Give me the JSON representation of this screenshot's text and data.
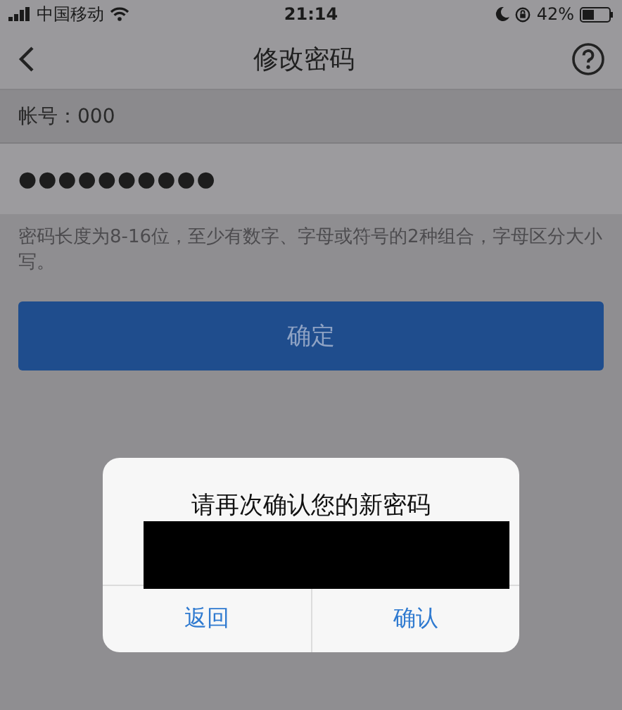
{
  "status_bar": {
    "carrier": "中国移动",
    "time": "21:14",
    "battery": "42%"
  },
  "nav_bar": {
    "title": "修改密码"
  },
  "form": {
    "account": "帐号：000",
    "password": "●●●●●●●●●●",
    "hint": "密码长度为8-16位，至少有数字、字母或符号的2种组合，字母区分大小写。",
    "submit": "确定"
  },
  "dialog": {
    "title": "请再次确认您的新密码",
    "buttons": [
      {
        "label": "返回"
      },
      {
        "label": "确认"
      }
    ]
  }
}
